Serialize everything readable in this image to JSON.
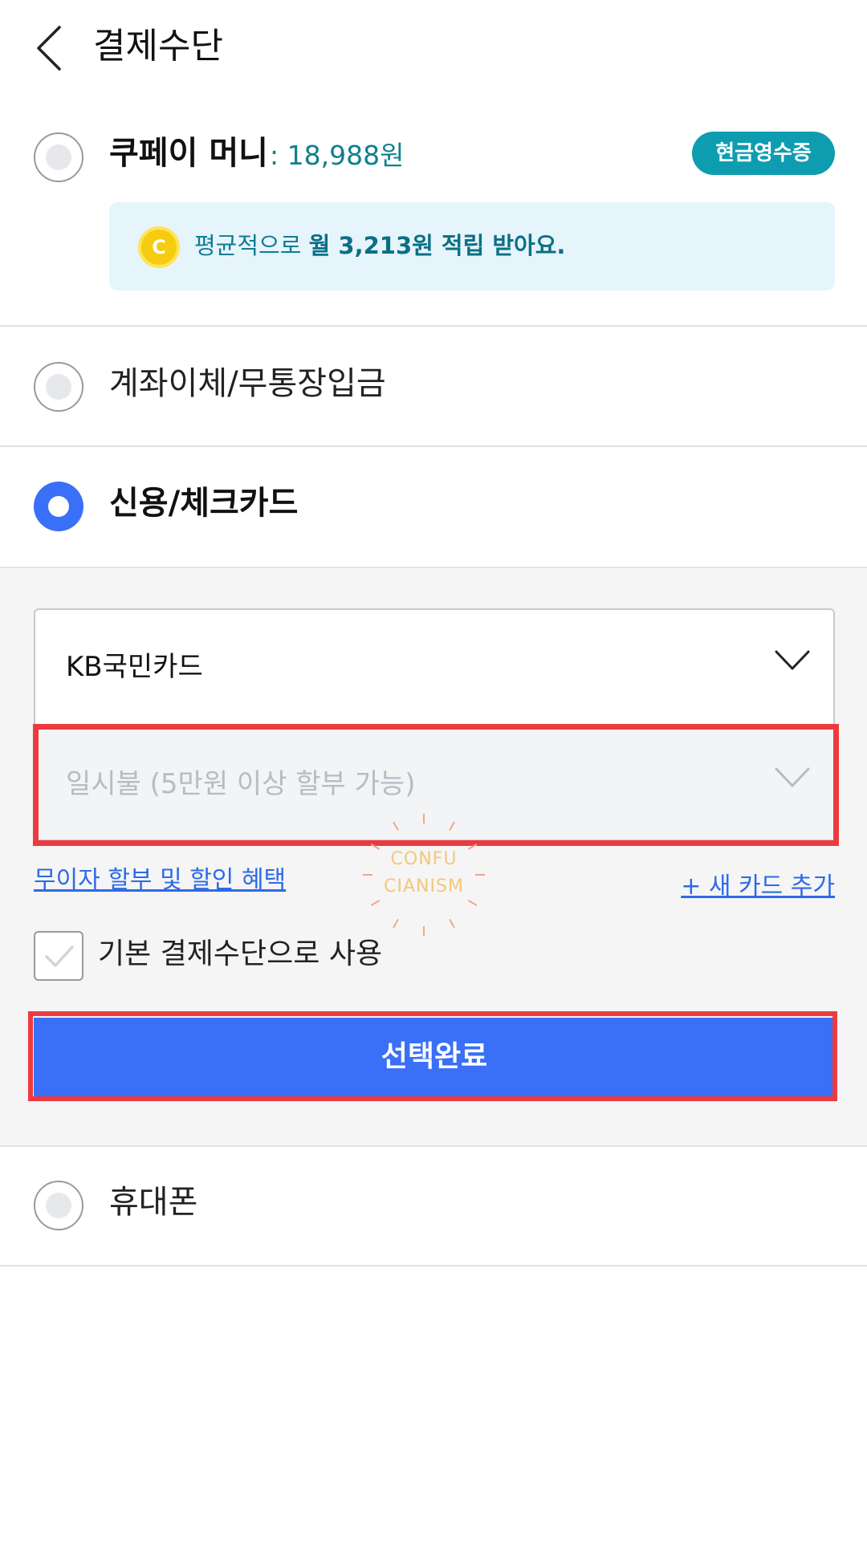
{
  "header": {
    "title": "결제수단"
  },
  "coupay": {
    "title": "쿠페이 머니",
    "amount": ": 18,988원",
    "cash_receipt_label": "현금영수증",
    "coin_letter": "C",
    "reward_prefix": "평균적으로 ",
    "reward_bold": "월 3,213원 적립 받아요."
  },
  "options": {
    "bank_transfer": "계좌이체/무통장입금",
    "credit_card": "신용/체크카드",
    "phone": "휴대폰"
  },
  "card_panel": {
    "card_select_value": "KB국민카드",
    "installment_placeholder": "일시불 (5만원 이상 할부 가능)",
    "benefit_link": "무이자 할부 및 할인 혜택",
    "new_card_link": "+ 새 카드 추가",
    "default_checkbox_label": "기본 결제수단으로 사용",
    "confirm_button": "선택완료"
  },
  "watermark": {
    "line1": "CONFU",
    "line2": "CIANISM"
  },
  "colors": {
    "accent_blue": "#3a6ff7",
    "teal": "#0e9db0",
    "highlight_red": "#ed3a3f"
  }
}
